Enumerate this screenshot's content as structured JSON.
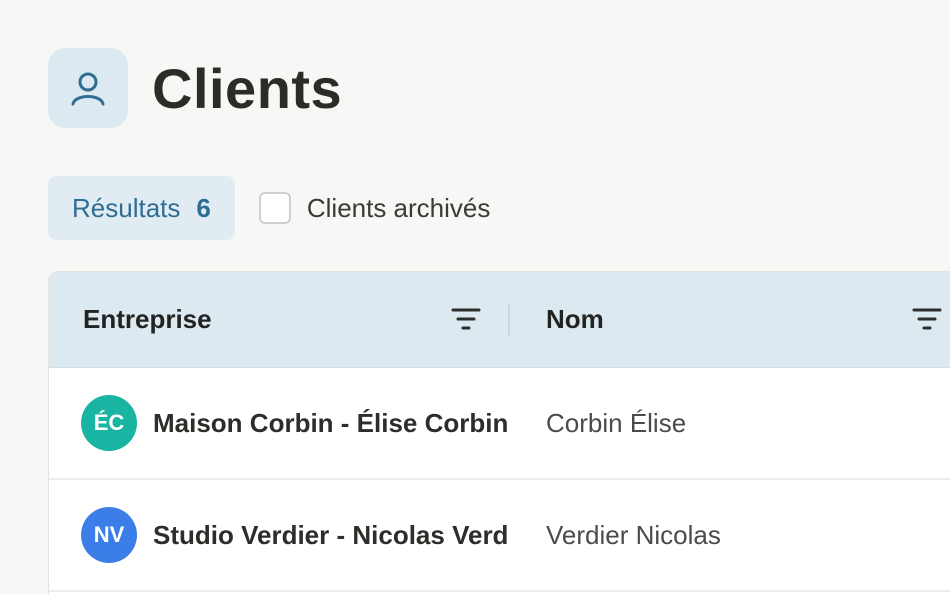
{
  "header": {
    "title": "Clients",
    "icon": "user-icon",
    "icon_color": "#2f6d93"
  },
  "filters": {
    "results_label": "Résultats",
    "results_count": "6",
    "archived_label": "Clients archivés",
    "archived_checked": false
  },
  "table": {
    "columns": [
      {
        "label": "Entreprise",
        "icon": "filter-icon"
      },
      {
        "label": "Nom",
        "icon": "filter-icon"
      }
    ],
    "rows": [
      {
        "initials": "ÉC",
        "avatar_color": "#1ab5a2",
        "company": "Maison Corbin - Élise Corbin",
        "name": "Corbin Élise"
      },
      {
        "initials": "NV",
        "avatar_color": "#3b7ee8",
        "company": "Studio Verdier - Nicolas Verdier",
        "name": "Verdier Nicolas"
      }
    ]
  }
}
